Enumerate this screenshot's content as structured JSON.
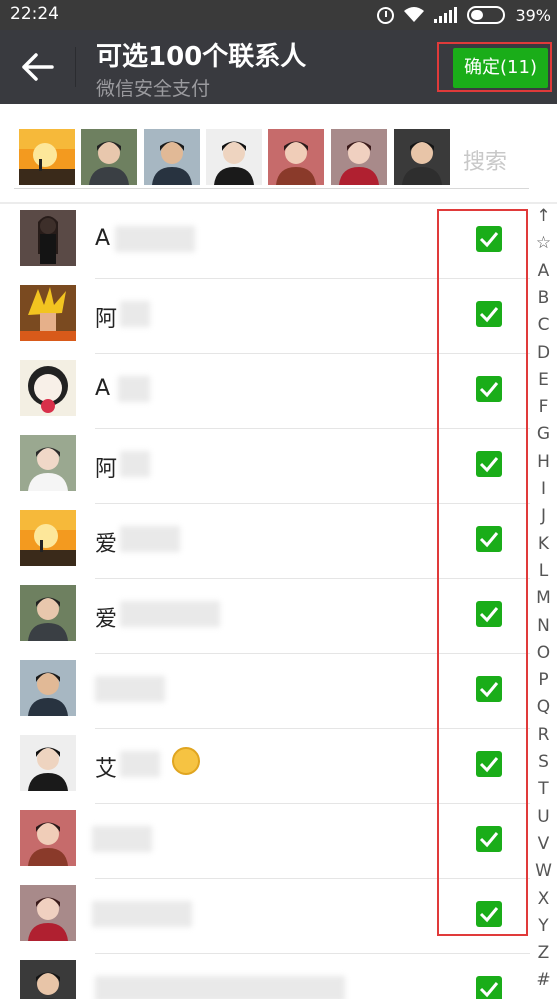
{
  "status_bar": {
    "time": "22:24",
    "battery": "39%",
    "battery_fraction": 0.39,
    "icons": [
      "alarm-icon",
      "wifi-icon",
      "signal-icon",
      "battery-icon"
    ]
  },
  "header": {
    "title": "可选100个联系人",
    "subtitle": "微信安全支付",
    "confirm_label": "确定(11)",
    "back_icon": "arrow-left-icon"
  },
  "search": {
    "placeholder": "搜索"
  },
  "selected_avatars": [
    {
      "kind": "sunset"
    },
    {
      "kind": "person-a"
    },
    {
      "kind": "person-b"
    },
    {
      "kind": "person-c"
    },
    {
      "kind": "person-d"
    },
    {
      "kind": "person-e"
    },
    {
      "kind": "person-f"
    }
  ],
  "contacts": [
    {
      "name": "A",
      "checked": true
    },
    {
      "name": "阿",
      "checked": true
    },
    {
      "name": "A",
      "checked": true
    },
    {
      "name": "阿",
      "checked": true
    },
    {
      "name": "爱",
      "checked": true
    },
    {
      "name": "爱",
      "checked": true
    },
    {
      "name": "",
      "checked": true
    },
    {
      "name": "艾",
      "checked": true
    },
    {
      "name": "",
      "checked": true
    },
    {
      "name": "",
      "checked": true
    },
    {
      "name": "",
      "checked": true
    }
  ],
  "index_letters": [
    "↑",
    "☆",
    "A",
    "B",
    "C",
    "D",
    "E",
    "F",
    "G",
    "H",
    "I",
    "J",
    "K",
    "L",
    "M",
    "N",
    "O",
    "P",
    "Q",
    "R",
    "S",
    "T",
    "U",
    "V",
    "W",
    "X",
    "Y",
    "Z",
    "#"
  ],
  "colors": {
    "header_bg": "#393a3f",
    "accent_green": "#1aad19",
    "highlight_red": "#e03a3a"
  }
}
